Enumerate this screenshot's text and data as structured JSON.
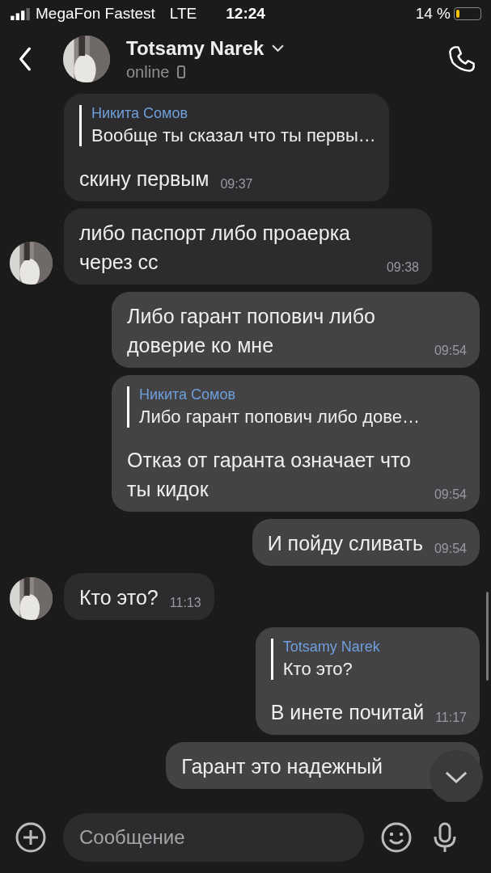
{
  "status_bar": {
    "carrier": "MegaFon Fastest",
    "network": "LTE",
    "time": "12:24",
    "battery": "14 %"
  },
  "header": {
    "name": "Totsamy Narek",
    "status": "online"
  },
  "messages": [
    {
      "kind": "incoming",
      "avatar": false,
      "reply": {
        "author": "Никита Сомов",
        "text": "Вообще ты сказал что ты первы…"
      },
      "text": "скину первым",
      "time": "09:37"
    },
    {
      "kind": "incoming",
      "avatar": true,
      "text": "либо паспорт либо проаерка через сс",
      "time": "09:38"
    },
    {
      "kind": "outgoing",
      "text": "Либо гарант попович либо доверие ко мне",
      "time": "09:54"
    },
    {
      "kind": "outgoing",
      "reply": {
        "author": "Никита Сомов",
        "text": "Либо гарант попович либо дове…"
      },
      "text": "Отказ от гаранта означает что ты кидок",
      "time": "09:54"
    },
    {
      "kind": "outgoing",
      "text": "И пойду сливать",
      "time": "09:54"
    },
    {
      "kind": "incoming",
      "avatar": true,
      "text": "Кто это?",
      "time": "11:13"
    },
    {
      "kind": "outgoing",
      "reply": {
        "author": "Totsamy Narek",
        "text": "Кто это?"
      },
      "text": "В инете почитай",
      "time": "11:17"
    },
    {
      "kind": "outgoing",
      "text": "Гарант это надежный"
    }
  ],
  "composer": {
    "placeholder": "Сообщение"
  }
}
